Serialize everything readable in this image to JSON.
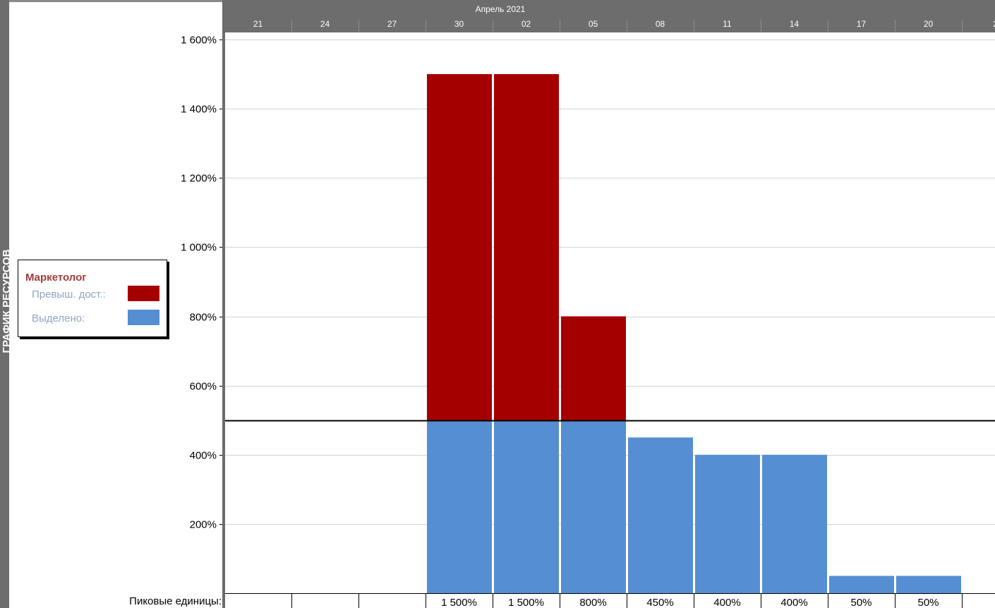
{
  "side_panel_label": "ГРАФИК РЕСУРСОВ",
  "timescale": {
    "month": "Апрель 2021",
    "days": [
      "21",
      "24",
      "27",
      "30",
      "02",
      "05",
      "08",
      "11",
      "14",
      "17",
      "20",
      "2"
    ]
  },
  "legend": {
    "title": "Маркетолог",
    "overallocated_label": "Превыш. дост.:",
    "allocated_label": "Выделено:",
    "overallocated_color": "#a40000",
    "allocated_color": "#558ed2"
  },
  "peak_units_label": "Пиковые единицы:",
  "chart_data": {
    "type": "bar",
    "stacked": true,
    "categories": [
      "21",
      "24",
      "27",
      "30",
      "02",
      "05",
      "08",
      "11",
      "14",
      "17",
      "20"
    ],
    "series": [
      {
        "name": "Выделено:",
        "color": "#558ed2",
        "values": [
          0,
          0,
          0,
          500,
          500,
          500,
          450,
          400,
          400,
          50,
          50
        ]
      },
      {
        "name": "Превыш. дост.:",
        "color": "#a40000",
        "values": [
          0,
          0,
          0,
          1000,
          1000,
          300,
          0,
          0,
          0,
          0,
          0
        ]
      }
    ],
    "peak_units": [
      "",
      "",
      "",
      "1 500%",
      "1 500%",
      "800%",
      "450%",
      "400%",
      "400%",
      "50%",
      "50%"
    ],
    "max_units": 500,
    "ylim": [
      0,
      1600
    ],
    "yticks": [
      200,
      400,
      600,
      800,
      1000,
      1200,
      1400,
      1600
    ],
    "ytick_labels": [
      "200%",
      "400%",
      "600%",
      "800%",
      "1 000%",
      "1 200%",
      "1 400%",
      "1 600%"
    ],
    "grid": true
  }
}
